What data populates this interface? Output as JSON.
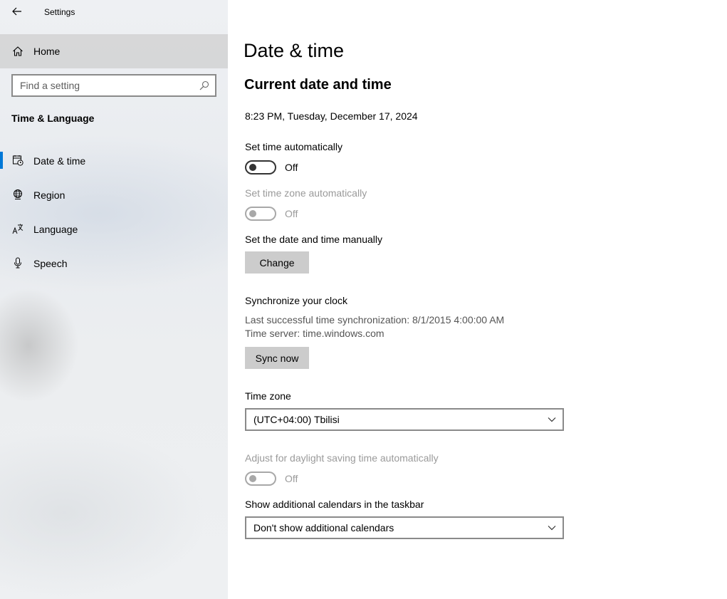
{
  "window": {
    "title": "Settings"
  },
  "sidebar": {
    "home_label": "Home",
    "search_placeholder": "Find a setting",
    "section_title": "Time & Language",
    "items": [
      {
        "label": "Date & time",
        "icon": "calendar-clock-icon",
        "selected": true
      },
      {
        "label": "Region",
        "icon": "globe-icon",
        "selected": false
      },
      {
        "label": "Language",
        "icon": "language-icon",
        "selected": false
      },
      {
        "label": "Speech",
        "icon": "microphone-icon",
        "selected": false
      }
    ]
  },
  "main": {
    "page_title": "Date & time",
    "section_title": "Current date and time",
    "current_datetime": "8:23 PM, Tuesday, December 17, 2024",
    "set_time_auto": {
      "label": "Set time automatically",
      "state": "Off",
      "enabled": true
    },
    "set_timezone_auto": {
      "label": "Set time zone automatically",
      "state": "Off",
      "enabled": false
    },
    "manual": {
      "label": "Set the date and time manually",
      "button": "Change"
    },
    "sync": {
      "label": "Synchronize your clock",
      "last_sync": "Last successful time synchronization: 8/1/2015 4:00:00 AM",
      "server": "Time server: time.windows.com",
      "button": "Sync now"
    },
    "timezone": {
      "label": "Time zone",
      "value": "(UTC+04:00) Tbilisi"
    },
    "dst": {
      "label": "Adjust for daylight saving time automatically",
      "state": "Off",
      "enabled": false
    },
    "calendars": {
      "label": "Show additional calendars in the taskbar",
      "value": "Don't show additional calendars"
    }
  },
  "colors": {
    "accent": "#0078d7",
    "button_bg": "#cccccc",
    "disabled_text": "#9a9a9a"
  }
}
